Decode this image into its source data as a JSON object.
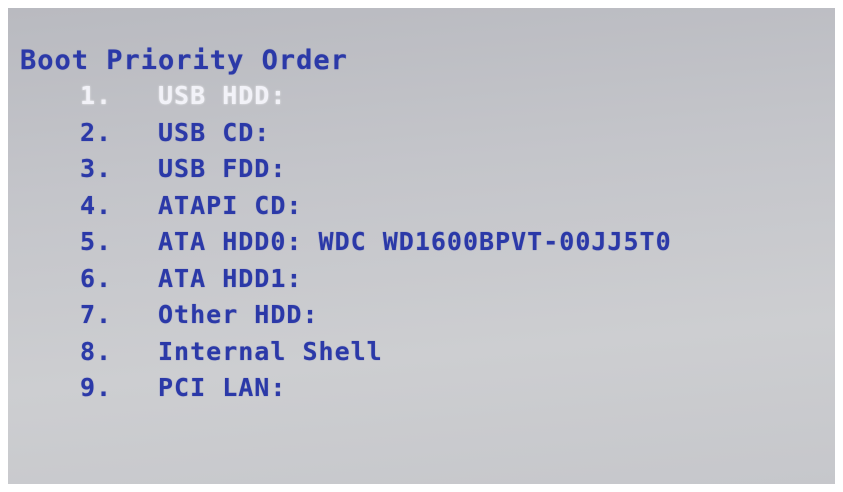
{
  "title": "Boot Priority Order",
  "colors": {
    "text": "#2b39a8",
    "selected_text": "#f2f2f8",
    "background": "#c4c5ca"
  },
  "items": [
    {
      "num": "1.",
      "label": "USB HDD:"
    },
    {
      "num": "2.",
      "label": "USB CD:"
    },
    {
      "num": "3.",
      "label": "USB FDD:"
    },
    {
      "num": "4.",
      "label": "ATAPI CD:"
    },
    {
      "num": "5.",
      "label": "ATA HDD0: WDC WD1600BPVT-00JJ5T0"
    },
    {
      "num": "6.",
      "label": "ATA HDD1:"
    },
    {
      "num": "7.",
      "label": "Other HDD:"
    },
    {
      "num": "8.",
      "label": "Internal Shell"
    },
    {
      "num": "9.",
      "label": "PCI LAN:"
    }
  ]
}
